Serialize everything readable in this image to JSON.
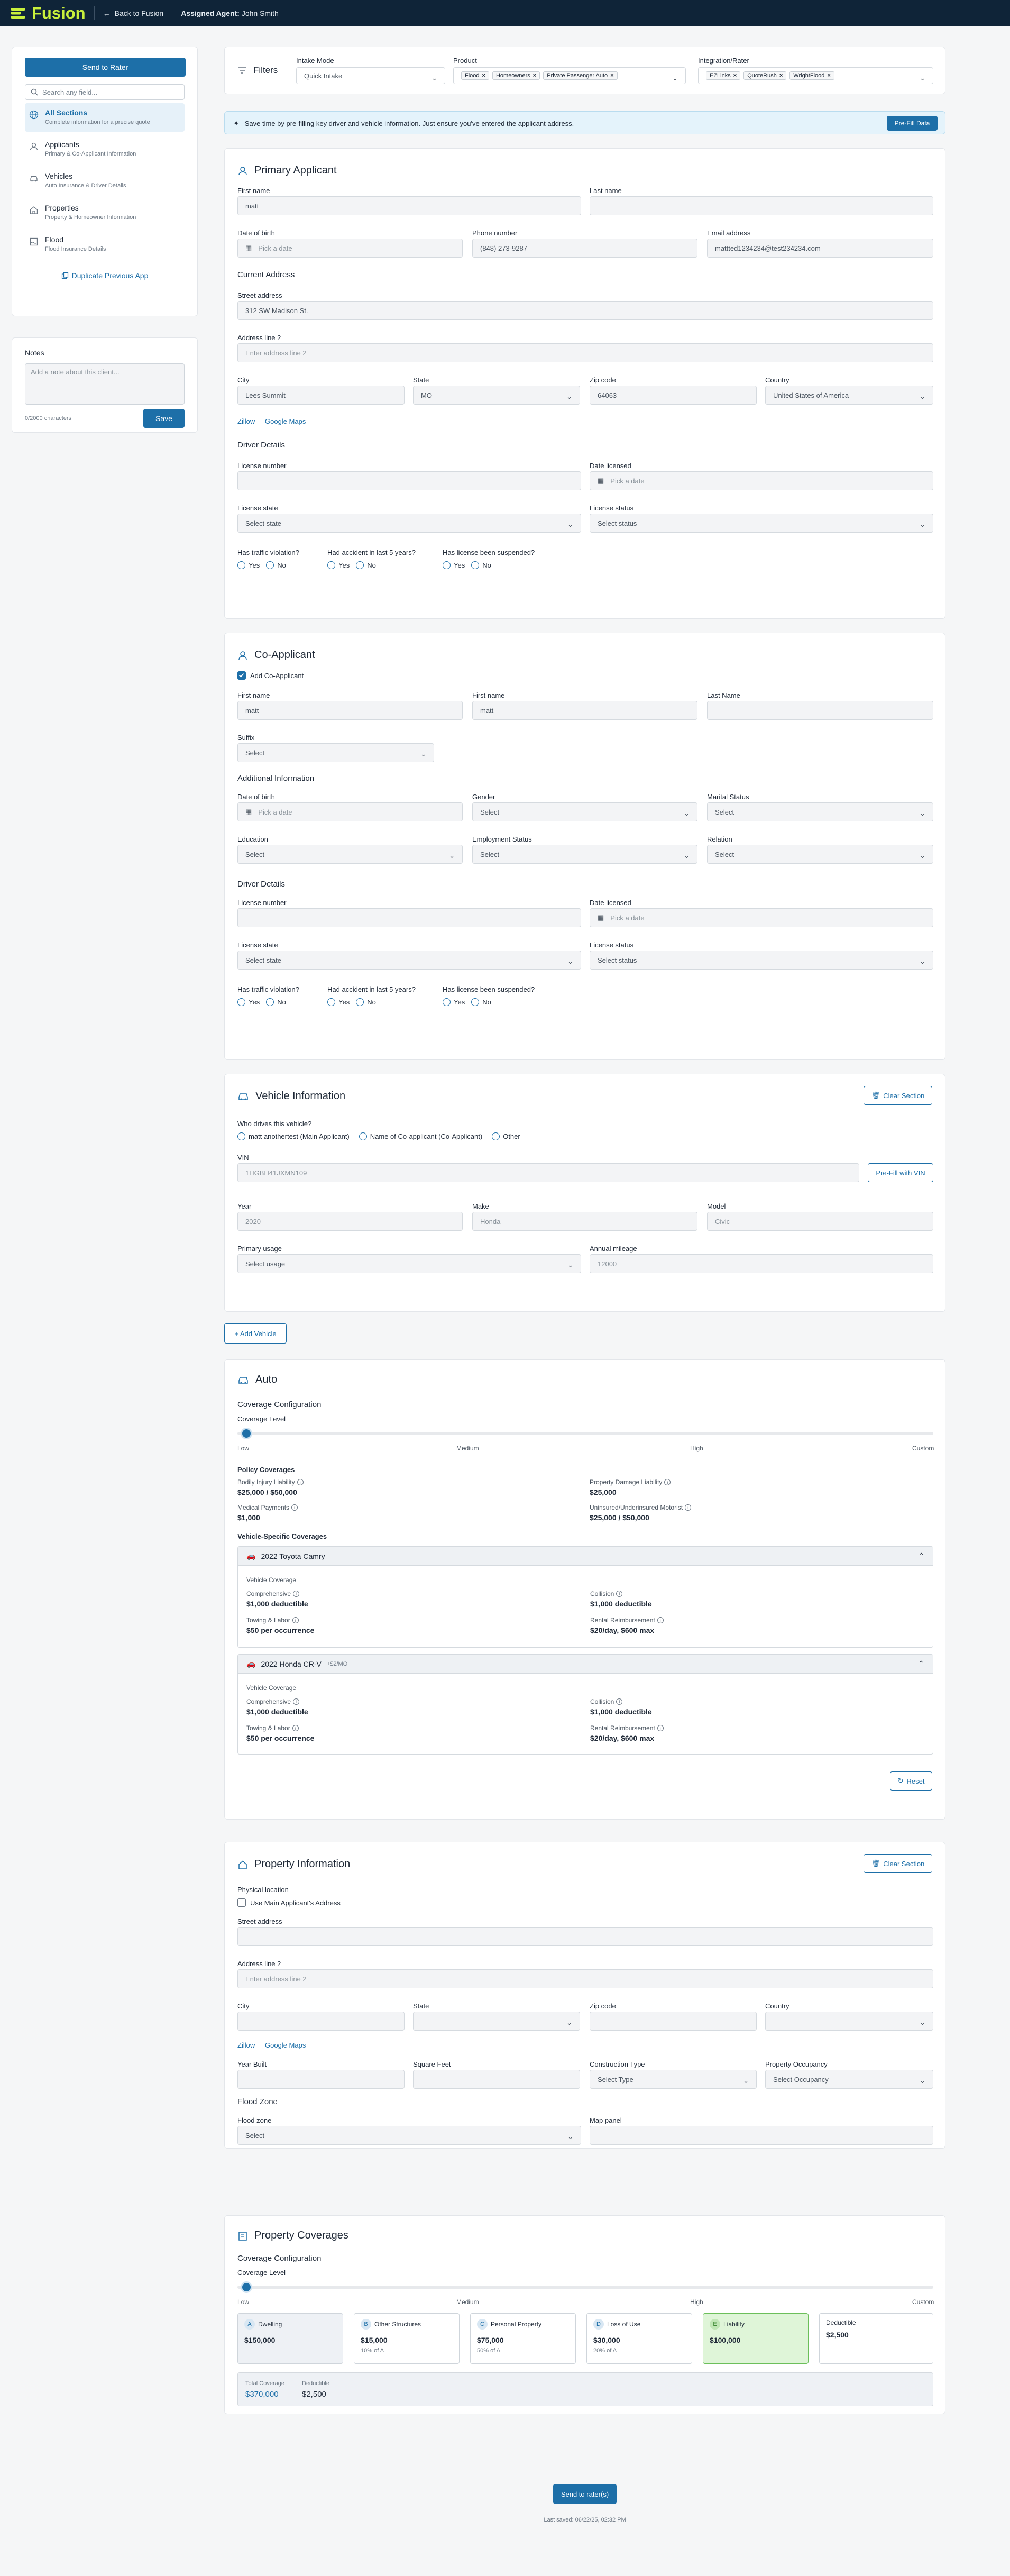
{
  "topbar": {
    "brand": "Fusion",
    "back": "Back to Fusion",
    "agent_label": "Assigned Agent:",
    "agent_name": "John Smith"
  },
  "sidebar": {
    "send_button": "Send to Rater",
    "search_placeholder": "Search any field...",
    "items": [
      {
        "title": "All Sections",
        "sub": "Complete information for a precise quote",
        "icon": "globe-icon"
      },
      {
        "title": "Applicants",
        "sub": "Primary & Co-Applicant Information",
        "icon": "person-icon"
      },
      {
        "title": "Vehicles",
        "sub": "Auto Insurance & Driver Details",
        "icon": "car-icon"
      },
      {
        "title": "Properties",
        "sub": "Property & Homeowner Information",
        "icon": "house-icon"
      },
      {
        "title": "Flood",
        "sub": "Flood Insurance Details",
        "icon": "flood-icon"
      }
    ],
    "duplicate": "Duplicate Previous App"
  },
  "notes": {
    "title": "Notes",
    "placeholder": "Add a note about this client...",
    "count": "0/2000 characters",
    "save": "Save"
  },
  "filters": {
    "title": "Filters",
    "intake_label": "Intake Mode",
    "intake_value": "Quick Intake",
    "product_label": "Product",
    "products": [
      "Flood",
      "Homeowners",
      "Private Passenger Auto"
    ],
    "rater_label": "Integration/Rater",
    "raters": [
      "EZLinks",
      "QuoteRush",
      "WrightFlood"
    ]
  },
  "prefill": {
    "text": "Save time by pre-filling key driver and vehicle information. Just ensure you've entered the applicant address.",
    "button": "Pre-Fill Data"
  },
  "primary": {
    "title": "Primary Applicant",
    "first_name_label": "First name",
    "first_name": "matt",
    "last_name_label": "Last name",
    "last_name": "",
    "dob_label": "Date of birth",
    "dob_ph": "Pick a date",
    "phone_label": "Phone number",
    "phone": "(848) 273-9287",
    "email_label": "Email address",
    "email": "mattted1234234@test234234.com",
    "current_address": "Current Address",
    "street_label": "Street address",
    "street": "312 SW Madison St.",
    "address2_label": "Address line 2",
    "address2_ph": "Enter address line 2",
    "city_label": "City",
    "city": "Lees Summit",
    "state_label": "State",
    "state": "MO",
    "zip_label": "Zip code",
    "zip": "64063",
    "country_label": "Country",
    "country": "United States of America",
    "zillow": "Zillow",
    "gmaps": "Google Maps",
    "driver_details": "Driver Details",
    "license_num_label": "License number",
    "date_licensed_label": "Date licensed",
    "date_licensed_ph": "Pick a date",
    "license_state_label": "License state",
    "license_state_ph": "Select state",
    "license_status_label": "License status",
    "license_status_ph": "Select status",
    "q1": "Has traffic violation?",
    "q2": "Had accident in last 5 years?",
    "q3": "Has license been suspended?",
    "yes": "Yes",
    "no": "No"
  },
  "co": {
    "title": "Co-Applicant",
    "add_label": "Add Co-Applicant",
    "first_label": "First name",
    "first": "matt",
    "first2_label": "First name",
    "first2": "matt",
    "last_label": "Last Name",
    "suffix_label": "Suffix",
    "suffix_ph": "Select",
    "additional": "Additional Information",
    "dob_label": "Date of birth",
    "dob_ph": "Pick a date",
    "gender_label": "Gender",
    "gender_ph": "Select",
    "marital_label": "Marital Status",
    "marital_ph": "Select",
    "education_label": "Education",
    "education_ph": "Select",
    "employment_label": "Employment Status",
    "employment_ph": "Select",
    "relation_label": "Relation",
    "relation_ph": "Select",
    "driver_details": "Driver Details",
    "license_num_label": "License number",
    "date_licensed_label": "Date licensed",
    "date_licensed_ph": "Pick a date",
    "license_state_label": "License state",
    "license_state_ph": "Select state",
    "license_status_label": "License status",
    "license_status_ph": "Select status",
    "q1": "Has traffic violation?",
    "q2": "Had accident in last 5 years?",
    "q3": "Has license been suspended?",
    "yes": "Yes",
    "no": "No"
  },
  "vehicle": {
    "title": "Vehicle Information",
    "clear": "Clear Section",
    "who_label": "Who drives this vehicle?",
    "drivers": [
      "matt anothertest (Main Applicant)",
      "Name of Co-applicant (Co-Applicant)",
      "Other"
    ],
    "vin_label": "VIN",
    "vin": "1HGBH41JXMN109",
    "prefill_vin": "Pre-Fill with VIN",
    "year_label": "Year",
    "year": "2020",
    "make_label": "Make",
    "make": "Honda",
    "model_label": "Model",
    "model": "Civic",
    "usage_label": "Primary usage",
    "usage_ph": "Select usage",
    "mileage_label": "Annual mileage",
    "mileage": "12000",
    "add_vehicle": "+ Add Vehicle"
  },
  "auto": {
    "title": "Auto",
    "config": "Coverage Configuration",
    "level": "Coverage Level",
    "levels": [
      "Low",
      "Medium",
      "High",
      "Custom"
    ],
    "level_value": 0,
    "policy": "Policy Coverages",
    "coverages": [
      {
        "label": "Bodily Injury Liability",
        "value": "$25,000 / $50,000"
      },
      {
        "label": "Property Damage Liability",
        "value": "$25,000"
      },
      {
        "label": "Medical Payments",
        "value": "$1,000"
      },
      {
        "label": "Uninsured/Underinsured Motorist",
        "value": "$25,000 / $50,000"
      }
    ],
    "vehicle_specific": "Vehicle-Specific Coverages",
    "vehicles": [
      {
        "name": "2022 Toyota Camry",
        "extra": "",
        "section": "Vehicle Coverage",
        "items": [
          {
            "label": "Comprehensive",
            "value": "$1,000 deductible"
          },
          {
            "label": "Collision",
            "value": "$1,000 deductible"
          },
          {
            "label": "Towing & Labor",
            "value": "$50 per occurrence"
          },
          {
            "label": "Rental Reimbursement",
            "value": "$20/day, $600 max"
          }
        ]
      },
      {
        "name": "2022 Honda CR-V",
        "extra": "+$2/MO",
        "section": "Vehicle Coverage",
        "items": [
          {
            "label": "Comprehensive",
            "value": "$1,000 deductible"
          },
          {
            "label": "Collision",
            "value": "$1,000 deductible"
          },
          {
            "label": "Towing & Labor",
            "value": "$50 per occurrence"
          },
          {
            "label": "Rental Reimbursement",
            "value": "$20/day, $600 max"
          }
        ]
      }
    ],
    "reset": "Reset"
  },
  "property": {
    "title": "Property Information",
    "clear": "Clear Section",
    "physical": "Physical location",
    "use_main": "Use Main Applicant's Address",
    "street_label": "Street address",
    "address2_label": "Address line 2",
    "address2_ph": "Enter address line 2",
    "city_label": "City",
    "state_label": "State",
    "zip_label": "Zip code",
    "country_label": "Country",
    "zillow": "Zillow",
    "gmaps": "Google Maps",
    "year_built_label": "Year Built",
    "sqft_label": "Square Feet",
    "construction_label": "Construction Type",
    "construction_ph": "Select Type",
    "occupancy_label": "Property Occupancy",
    "occupancy_ph": "Select Occupancy",
    "flood_zone_title": "Flood Zone",
    "flood_zone_label": "Flood zone",
    "flood_zone_ph": "Select",
    "map_panel_label": "Map panel"
  },
  "propcov": {
    "title": "Property Coverages",
    "config": "Coverage Configuration",
    "level": "Coverage Level",
    "levels": [
      "Low",
      "Medium",
      "High",
      "Custom"
    ],
    "level_value": 0,
    "boxes": [
      {
        "letter": "A",
        "name": "Dwelling",
        "value": "$150,000",
        "sub": ""
      },
      {
        "letter": "B",
        "name": "Other Structures",
        "value": "$15,000",
        "sub": "10% of A"
      },
      {
        "letter": "C",
        "name": "Personal Property",
        "value": "$75,000",
        "sub": "50% of A"
      },
      {
        "letter": "D",
        "name": "Loss of Use",
        "value": "$30,000",
        "sub": "20% of A"
      },
      {
        "letter": "E",
        "name": "Liability",
        "value": "$100,000",
        "sub": ""
      }
    ],
    "deductible_label": "Deductible",
    "deductible": "$2,500",
    "total_label": "Total Coverage",
    "total": "$370,000",
    "total_ded_label": "Deductible",
    "total_ded": "$2,500"
  },
  "footer": {
    "send": "Send to rater(s)",
    "saved": "Last saved: 06/22/25, 02:32 PM"
  }
}
